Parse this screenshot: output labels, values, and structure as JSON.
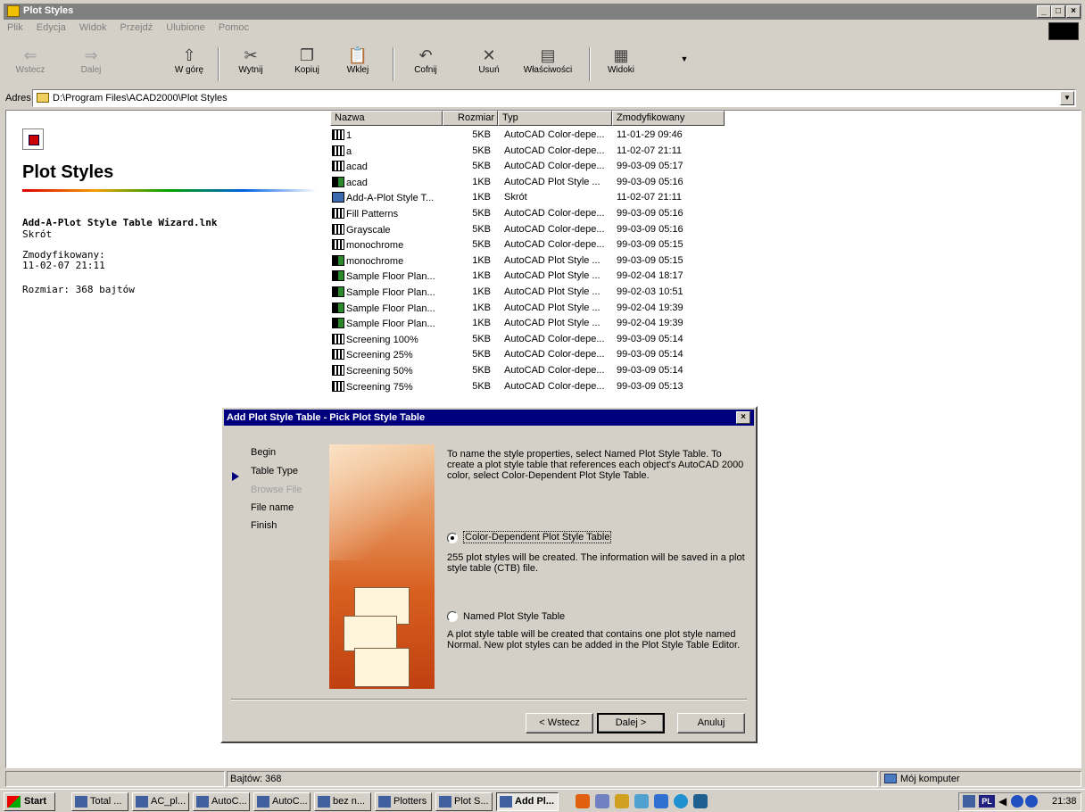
{
  "window": {
    "title": "Plot Styles",
    "min_label": "_",
    "max_label": "□",
    "close_label": "×"
  },
  "menu": [
    "Plik",
    "Edycja",
    "Widok",
    "Przejdź",
    "Ulubione",
    "Pomoc"
  ],
  "toolbar": {
    "back": "Wstecz",
    "forward": "Dalej",
    "up": "W górę",
    "cut": "Wytnij",
    "copy": "Kopiuj",
    "paste": "Wklej",
    "undo": "Cofnij",
    "delete": "Usuń",
    "properties": "Właściwości",
    "views": "Widoki"
  },
  "address": {
    "label": "Adres",
    "path": "D:\\Program Files\\ACAD2000\\Plot Styles"
  },
  "left_panel": {
    "title": "Plot Styles",
    "file_name": "Add-A-Plot Style Table Wizard.lnk",
    "file_type": "Skrót",
    "modified_label": "Zmodyfikowany:",
    "modified_value": "11-02-07 21:11",
    "size": "Rozmiar: 368 bajtów"
  },
  "columns": {
    "name": "Nazwa",
    "size": "Rozmiar",
    "type": "Typ",
    "modified": "Zmodyfikowany"
  },
  "files": [
    {
      "name": "1",
      "size": "5KB",
      "type": "AutoCAD Color-depe...",
      "modified": "11-01-29 09:46",
      "kind": "ctb"
    },
    {
      "name": "a",
      "size": "5KB",
      "type": "AutoCAD Color-depe...",
      "modified": "11-02-07 21:11",
      "kind": "ctb"
    },
    {
      "name": "acad",
      "size": "5KB",
      "type": "AutoCAD Color-depe...",
      "modified": "99-03-09 05:17",
      "kind": "ctb"
    },
    {
      "name": "acad",
      "size": "1KB",
      "type": "AutoCAD Plot Style ...",
      "modified": "99-03-09 05:16",
      "kind": "stb"
    },
    {
      "name": "Add-A-Plot Style T...",
      "size": "1KB",
      "type": "Skrót",
      "modified": "11-02-07 21:11",
      "kind": "lnk"
    },
    {
      "name": "Fill Patterns",
      "size": "5KB",
      "type": "AutoCAD Color-depe...",
      "modified": "99-03-09 05:16",
      "kind": "ctb"
    },
    {
      "name": "Grayscale",
      "size": "5KB",
      "type": "AutoCAD Color-depe...",
      "modified": "99-03-09 05:16",
      "kind": "ctb"
    },
    {
      "name": "monochrome",
      "size": "5KB",
      "type": "AutoCAD Color-depe...",
      "modified": "99-03-09 05:15",
      "kind": "ctb"
    },
    {
      "name": "monochrome",
      "size": "1KB",
      "type": "AutoCAD Plot Style ...",
      "modified": "99-03-09 05:15",
      "kind": "stb"
    },
    {
      "name": "Sample Floor Plan...",
      "size": "1KB",
      "type": "AutoCAD Plot Style ...",
      "modified": "99-02-04 18:17",
      "kind": "stb"
    },
    {
      "name": "Sample Floor Plan...",
      "size": "1KB",
      "type": "AutoCAD Plot Style ...",
      "modified": "99-02-03 10:51",
      "kind": "stb"
    },
    {
      "name": "Sample Floor Plan...",
      "size": "1KB",
      "type": "AutoCAD Plot Style ...",
      "modified": "99-02-04 19:39",
      "kind": "stb"
    },
    {
      "name": "Sample Floor Plan...",
      "size": "1KB",
      "type": "AutoCAD Plot Style ...",
      "modified": "99-02-04 19:39",
      "kind": "stb"
    },
    {
      "name": "Screening 100%",
      "size": "5KB",
      "type": "AutoCAD Color-depe...",
      "modified": "99-03-09 05:14",
      "kind": "ctb"
    },
    {
      "name": "Screening 25%",
      "size": "5KB",
      "type": "AutoCAD Color-depe...",
      "modified": "99-03-09 05:14",
      "kind": "ctb"
    },
    {
      "name": "Screening 50%",
      "size": "5KB",
      "type": "AutoCAD Color-depe...",
      "modified": "99-03-09 05:14",
      "kind": "ctb"
    },
    {
      "name": "Screening 75%",
      "size": "5KB",
      "type": "AutoCAD Color-depe...",
      "modified": "99-03-09 05:13",
      "kind": "ctb"
    }
  ],
  "dialog": {
    "title": "Add Plot Style Table - Pick Plot Style Table",
    "close_label": "×",
    "steps": [
      {
        "label": "Begin",
        "state": "normal"
      },
      {
        "label": "Table Type",
        "state": "current"
      },
      {
        "label": "Browse File",
        "state": "disabled"
      },
      {
        "label": "File name",
        "state": "normal"
      },
      {
        "label": "Finish",
        "state": "normal"
      }
    ],
    "intro": "To name the style properties, select Named Plot Style Table. To create a plot style table that references each object's AutoCAD 2000 color, select Color-Dependent Plot Style Table.",
    "option1_label": "Color-Dependent Plot Style Table",
    "option1_desc": "255 plot styles will be created. The information will be saved in a plot style table (CTB) file.",
    "option2_label": "Named Plot Style Table",
    "option2_desc": "A plot style table will be created that contains one plot style named Normal.  New plot styles can be added in the Plot Style Table Editor.",
    "back_button": "< Wstecz",
    "next_button": "Dalej >",
    "cancel_button": "Anuluj"
  },
  "status": {
    "bytes": "Bajtów: 368",
    "location": "Mój komputer"
  },
  "taskbar": {
    "start": "Start",
    "buttons": [
      "Total ...",
      "AC_pl...",
      "AutoC...",
      "AutoC...",
      "bez n...",
      "Plotters",
      "Plot S...",
      "Add Pl..."
    ],
    "lang": "PL",
    "clock": "21:38"
  }
}
